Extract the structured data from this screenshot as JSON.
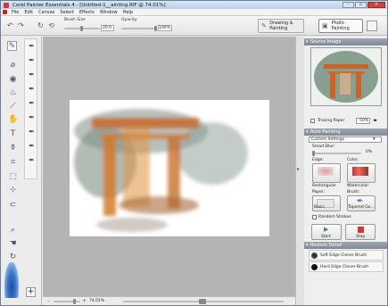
{
  "window": {
    "title": "Corel Painter Essentials 4 - [Untitled-1__ainting.RIF @ 74.01%]",
    "controls": {
      "minimize": "–",
      "maximize": "▫",
      "close": "✕"
    }
  },
  "menu": [
    "File",
    "Edit",
    "Canvas",
    "Select",
    "Effects",
    "Window",
    "Help"
  ],
  "toolbar": {
    "brush_size_label": "Brush Size",
    "brush_size_value": "20.0",
    "opacity_label": "Opacity:",
    "opacity_value": "100%",
    "modes": {
      "drawing": "Drawing & Painting",
      "photo": "Photo Painting"
    }
  },
  "status": {
    "zoom": "74.01%"
  },
  "panel": {
    "source_image": {
      "header": "Source Image",
      "tracing_paper_label": "Tracing Paper",
      "opacity_value": "50%"
    },
    "auto_painting": {
      "header": "Auto-Painting",
      "preset": "Custom Settings",
      "smart_blur_label": "Smart Blur:",
      "smart_blur_value": "0%",
      "edge_label": "Edge:",
      "edge_value": "Rectangular",
      "color_label": "Color:",
      "color_value": "Watercolor",
      "paper_label": "Paper:",
      "paper_value": "Basic",
      "brush_label": "Brush:",
      "brush_value": "Tapered Go...",
      "random_strokes_label": "Random Strokes",
      "start_label": "Start",
      "stop_label": "Stop"
    },
    "restore_detail": {
      "header": "Restore Detail",
      "options": [
        "Soft Edge Cloner Brush",
        "Hard Edge Cloner Brush"
      ]
    }
  },
  "colors": {
    "accent_blue": "#2f66b8",
    "torii_orange": "#d97a2b",
    "stop_red": "#d23b2b",
    "start_green": "#3c9a3c"
  }
}
